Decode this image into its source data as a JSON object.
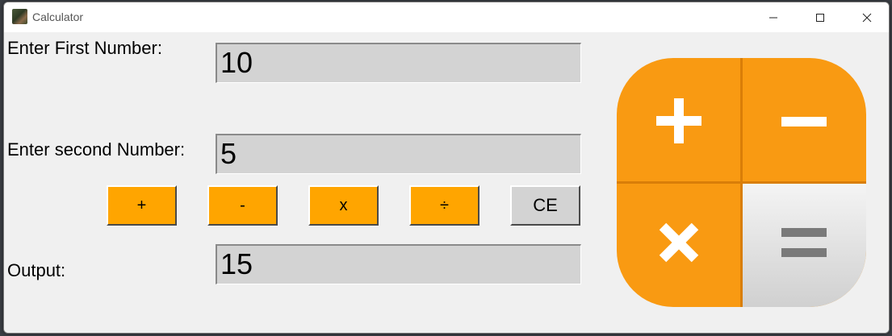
{
  "window": {
    "title": "Calculator"
  },
  "form": {
    "first_label": "Enter First Number:",
    "first_value": "10",
    "second_label": "Enter second Number:",
    "second_value": "5",
    "output_label": "Output:",
    "output_value": "15"
  },
  "buttons": {
    "add": "+",
    "subtract": "-",
    "multiply": "x",
    "divide": "÷",
    "clear": "CE"
  },
  "colors": {
    "accent": "#ffa500",
    "field_bg": "#d3d3d3",
    "logo_orange": "#f99a12"
  },
  "icons": {
    "app": "app-photo-icon",
    "logo": "calculator-logo-icon"
  }
}
